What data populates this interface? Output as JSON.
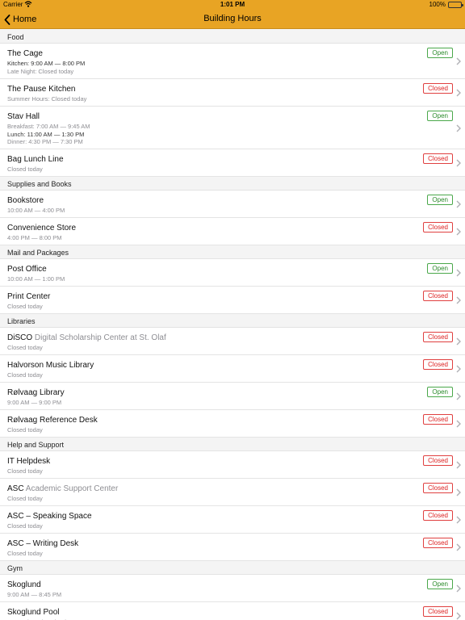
{
  "status": {
    "carrier": "Carrier",
    "time": "1:01 PM",
    "battery": "100%"
  },
  "nav": {
    "back_label": "Home",
    "title": "Building Hours"
  },
  "colors": {
    "accent": "#e8a424",
    "open": "#4aa84a",
    "closed": "#e04040"
  },
  "sections": [
    {
      "title": "Food",
      "rows": [
        {
          "name": "The Cage",
          "sub": "",
          "status": "Open",
          "lines": [
            {
              "text": "Kitchen: 9:00 AM — 8:00 PM",
              "strong": true
            },
            {
              "text": "Late Night: Closed today",
              "strong": false
            }
          ]
        },
        {
          "name": "The Pause Kitchen",
          "sub": "",
          "status": "Closed",
          "lines": [
            {
              "text": "Summer Hours: Closed today",
              "strong": false
            }
          ]
        },
        {
          "name": "Stav Hall",
          "sub": "",
          "status": "Open",
          "lines": [
            {
              "text": "Breakfast: 7:00 AM — 9:45 AM",
              "strong": false
            },
            {
              "text": "Lunch: 11:00 AM — 1:30 PM",
              "strong": true
            },
            {
              "text": "Dinner: 4:30 PM — 7:30 PM",
              "strong": false
            }
          ]
        },
        {
          "name": "Bag Lunch Line",
          "sub": "",
          "status": "Closed",
          "lines": [
            {
              "text": "Closed today",
              "strong": false
            }
          ]
        }
      ]
    },
    {
      "title": "Supplies and Books",
      "rows": [
        {
          "name": "Bookstore",
          "sub": "",
          "status": "Open",
          "lines": [
            {
              "text": "10:00 AM — 4:00 PM",
              "strong": false
            }
          ]
        },
        {
          "name": "Convenience Store",
          "sub": "",
          "status": "Closed",
          "lines": [
            {
              "text": "4:00 PM — 8:00 PM",
              "strong": false
            }
          ]
        }
      ]
    },
    {
      "title": "Mail and Packages",
      "rows": [
        {
          "name": "Post Office",
          "sub": "",
          "status": "Open",
          "lines": [
            {
              "text": "10:00 AM — 1:00 PM",
              "strong": false
            }
          ]
        },
        {
          "name": "Print Center",
          "sub": "",
          "status": "Closed",
          "lines": [
            {
              "text": "Closed today",
              "strong": false
            }
          ]
        }
      ]
    },
    {
      "title": "Libraries",
      "rows": [
        {
          "name": "DiSCO",
          "sub": "Digital Scholarship Center at St. Olaf",
          "status": "Closed",
          "lines": [
            {
              "text": "Closed today",
              "strong": false
            }
          ]
        },
        {
          "name": "Halvorson Music Library",
          "sub": "",
          "status": "Closed",
          "lines": [
            {
              "text": "Closed today",
              "strong": false
            }
          ]
        },
        {
          "name": "Rølvaag Library",
          "sub": "",
          "status": "Open",
          "lines": [
            {
              "text": "9:00 AM — 9:00 PM",
              "strong": false
            }
          ]
        },
        {
          "name": "Rølvaag Reference Desk",
          "sub": "",
          "status": "Closed",
          "lines": [
            {
              "text": "Closed today",
              "strong": false
            }
          ]
        }
      ]
    },
    {
      "title": "Help and Support",
      "rows": [
        {
          "name": "IT Helpdesk",
          "sub": "",
          "status": "Closed",
          "lines": [
            {
              "text": "Closed today",
              "strong": false
            }
          ]
        },
        {
          "name": "ASC",
          "sub": "Academic Support Center",
          "status": "Closed",
          "lines": [
            {
              "text": "Closed today",
              "strong": false
            }
          ]
        },
        {
          "name": "ASC – Speaking Space",
          "sub": "",
          "status": "Closed",
          "lines": [
            {
              "text": "Closed today",
              "strong": false
            }
          ]
        },
        {
          "name": "ASC – Writing Desk",
          "sub": "",
          "status": "Closed",
          "lines": [
            {
              "text": "Closed today",
              "strong": false
            }
          ]
        }
      ]
    },
    {
      "title": "Gym",
      "rows": [
        {
          "name": "Skoglund",
          "sub": "",
          "status": "Open",
          "lines": [
            {
              "text": "9:00 AM — 8:45 PM",
              "strong": false
            }
          ]
        },
        {
          "name": "Skoglund Pool",
          "sub": "",
          "status": "Closed",
          "lines": [
            {
              "text": "Lap Swim: Closed today",
              "strong": false
            }
          ]
        }
      ]
    }
  ]
}
